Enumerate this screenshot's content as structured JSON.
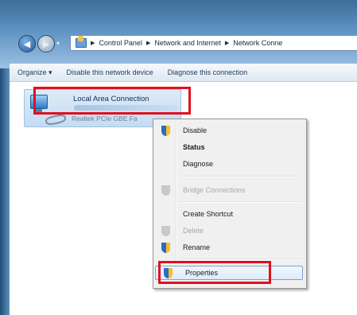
{
  "address_bar": {
    "crumbs": [
      "Control Panel",
      "Network and Internet",
      "Network Conne"
    ]
  },
  "toolbar": {
    "organize": "Organize ▾",
    "disable_device": "Disable this network device",
    "diagnose": "Diagnose this connection"
  },
  "connection": {
    "name": "Local Area Connection",
    "device": "Realtek PCIe GBE Fa"
  },
  "context_menu": {
    "items": [
      {
        "label": "Disable",
        "icon": "uac-shield-icon"
      },
      {
        "label": "Status"
      },
      {
        "label": "Diagnose"
      },
      {
        "label": "Bridge Connections",
        "icon": "uac-shield-icon"
      },
      {
        "label": "Create Shortcut"
      },
      {
        "label": "Delete",
        "icon": "uac-shield-icon"
      },
      {
        "label": "Rename",
        "icon": "uac-shield-icon"
      },
      {
        "label": "Properties",
        "icon": "uac-shield-icon"
      }
    ]
  },
  "colors": {
    "highlight_red": "#e0101d",
    "selection_blue": "#c4dcf3"
  }
}
